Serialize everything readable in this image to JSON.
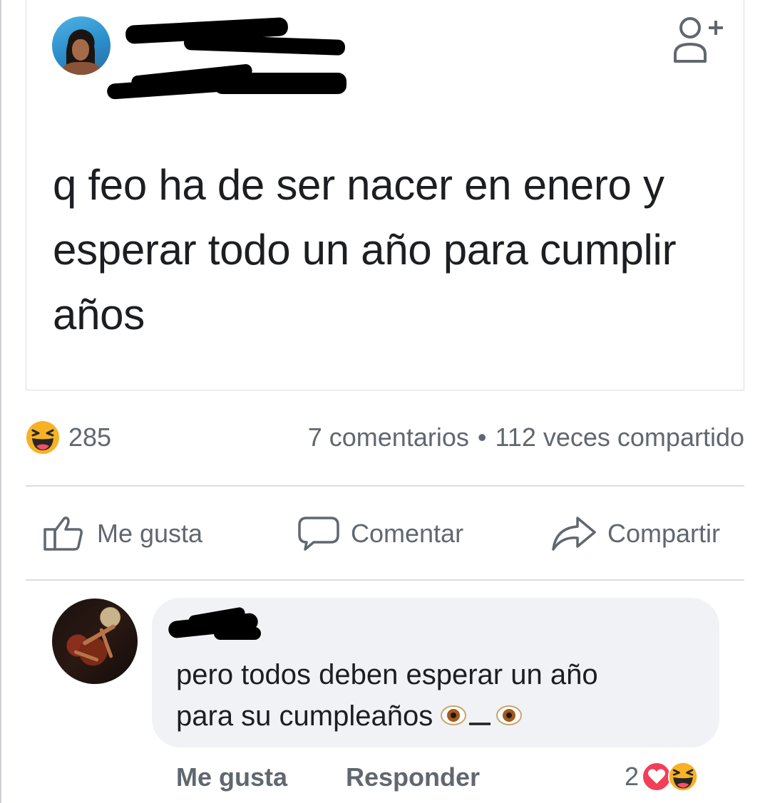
{
  "post": {
    "text": "q feo ha de ser nacer en enero y esperar todo un año para cumplir años",
    "author_redacted": true,
    "header_icon": "add-friend-icon"
  },
  "stats": {
    "reaction_icon": "haha-emoji",
    "reaction_count": "285",
    "comments_label": "7 comentarios",
    "separator": "•",
    "shares_label": "112 veces compartido"
  },
  "actions": {
    "like_label": "Me gusta",
    "comment_label": "Comentar",
    "share_label": "Compartir"
  },
  "comment": {
    "author_redacted": true,
    "text_line1": "pero todos deben esperar un año",
    "text_line2": "para su cumpleaños ",
    "emoji_face": "eye-underscore-eye",
    "like_label": "Me gusta",
    "reply_label": "Responder",
    "reaction_count": "2",
    "reaction_icons": [
      "love-emoji",
      "haha-emoji"
    ]
  },
  "colors": {
    "text_primary": "#1c1e21",
    "text_secondary": "#606770",
    "divider": "#dadde1",
    "bubble_bg": "#f0f2f5",
    "love_red": "#f33e58",
    "haha_yellow": "#f7b125"
  }
}
